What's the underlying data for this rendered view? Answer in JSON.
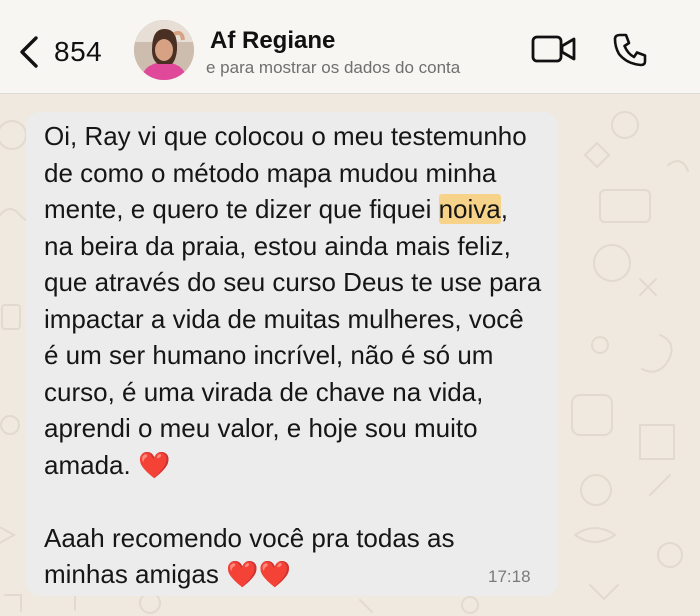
{
  "header": {
    "back_count": "854",
    "contact_name": "Af Regiane",
    "contact_subtitle": "e para mostrar os dados do conta",
    "icons": {
      "back": "chevron-left-icon",
      "video": "video-camera-icon",
      "phone": "phone-icon"
    }
  },
  "message": {
    "part1": "Oi, Ray vi que colocou o meu testemunho de como o método mapa mudou minha mente, e quero te dizer que fiquei ",
    "highlight": "noiva",
    "part2": ", na beira da praia, estou ainda mais feliz, que através do seu curso Deus te use para impactar a vida de muitas mulheres, você é um ser humano incrível, não é só um curso, é uma virada de chave na vida, aprendi o meu valor, e hoje sou muito amada. ",
    "heart1": "❤️",
    "part3": "\n\nAaah recomendo você pra todas as minhas amigas ",
    "heart2": "❤️❤️",
    "time": "17:18"
  },
  "colors": {
    "header_bg": "#f7f6f3",
    "wallpaper_bg": "#efe9df",
    "bubble_bg": "#ececec",
    "highlight": "#f7d38a",
    "heart": "#d61f26"
  }
}
